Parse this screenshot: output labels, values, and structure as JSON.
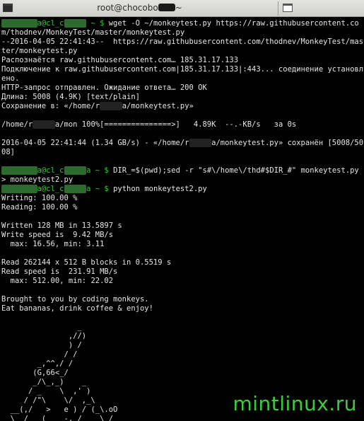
{
  "window": {
    "title_prefix": "root@chocobo",
    "title_suffix": "~",
    "left_icon": "terminal-icon",
    "right_icon": "terminal-tab-icon"
  },
  "terminal": {
    "prompt_host": "a@cl_c",
    "lines": [
      {
        "type": "cmd",
        "host": "a@cl_c",
        "path": " ~ $ ",
        "text": "wget -O ~/monkeytest.py https://raw.githubusercontent.com/thodnev/MonkeyTest/master/monkeytest.py"
      },
      {
        "type": "out",
        "text": "--2016-04-05 22:41:43--  https://raw.githubusercontent.com/thodnev/MonkeyTest/master/monkeytest.py"
      },
      {
        "type": "out",
        "text": "Распознаётся raw.githubusercontent.com… 185.31.17.133"
      },
      {
        "type": "out",
        "text": "Подключение к raw.githubusercontent.com|185.31.17.133|:443... соединение установлено."
      },
      {
        "type": "out",
        "text": "HTTP-запрос отправлен. Ожидание ответа… 200 OK"
      },
      {
        "type": "out",
        "text": "Длина: 5008 (4.9K) [text/plain]"
      },
      {
        "type": "out",
        "text": "Сохранение в: «/home/r▮▮▮▮▮a/monkeytest.py»"
      },
      {
        "type": "out",
        "text": ""
      },
      {
        "type": "out",
        "text": "/home/r▮▮▮▮▮a/mon 100%[===============>]   4.89K  --.-KB/s   за 0s"
      },
      {
        "type": "out",
        "text": ""
      },
      {
        "type": "out",
        "text": "2016-04-05 22:41:44 (1.34 GB/s) - «/home/r▮▮▮▮▮a/monkeytest.py» сохранён [5008/5008]"
      },
      {
        "type": "out",
        "text": ""
      },
      {
        "type": "cmd",
        "host": "a@cl_c",
        "path": "a ~ $ ",
        "text": "DIR_=$(pwd);sed -r \"s#\\/home\\/thd#$DIR_#\" monkeytest.py > monkeytest2.py"
      },
      {
        "type": "cmd",
        "host": "a@cl_c",
        "path": "a ~ $ ",
        "text": "python monkeytest2.py"
      },
      {
        "type": "out",
        "text": "Writing: 100.00 %"
      },
      {
        "type": "out",
        "text": "Reading: 100.00 %"
      },
      {
        "type": "out",
        "text": ""
      },
      {
        "type": "out",
        "text": "Written 128 MB in 13.5897 s"
      },
      {
        "type": "out",
        "text": "Write speed is  9.42 MB/s"
      },
      {
        "type": "out",
        "text": "  max: 16.56, min: 3.11"
      },
      {
        "type": "out",
        "text": ""
      },
      {
        "type": "out",
        "text": "Read 262144 x 512 B blocks in 0.5519 s"
      },
      {
        "type": "out",
        "text": "Read speed is  231.91 MB/s"
      },
      {
        "type": "out",
        "text": "  max: 512.00, min: 22.02"
      },
      {
        "type": "out",
        "text": ""
      },
      {
        "type": "out",
        "text": "Brought to you by coding monkeys."
      },
      {
        "type": "out",
        "text": "Eat bananas, drink coffee & enjoy!"
      },
      {
        "type": "out",
        "text": ""
      },
      {
        "type": "out",
        "text": "                 _"
      },
      {
        "type": "out",
        "text": "               ,//)"
      },
      {
        "type": "out",
        "text": "               ) /"
      },
      {
        "type": "out",
        "text": "              / /"
      },
      {
        "type": "out",
        "text": "        _,^^,/ /"
      },
      {
        "type": "out",
        "text": "       (G,66<_/"
      },
      {
        "type": "out",
        "text": "       _/\\_,_)    _"
      },
      {
        "type": "out",
        "text": "      / _    \\  ,' )"
      },
      {
        "type": "out",
        "text": "     / /\"\\    \\/  ,_\\"
      },
      {
        "type": "out",
        "text": "  __(,/   >   e ) / (_\\.oO"
      },
      {
        "type": "out",
        "text": "  \\_ /   (    -,_/    \\_/"
      }
    ]
  },
  "watermark": "mintlinux.ru"
}
